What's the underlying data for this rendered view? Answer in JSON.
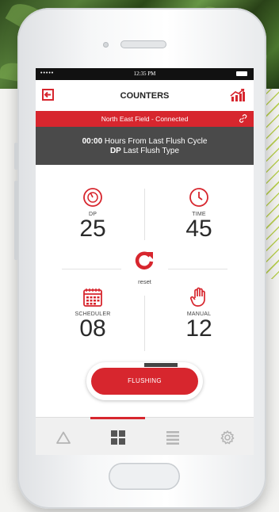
{
  "status_bar": {
    "signal": "••••• ",
    "time": "12:35 PM"
  },
  "header": {
    "title": "COUNTERS"
  },
  "connection": {
    "text": "North East Field - Connected"
  },
  "info": {
    "line1_bold": "00:00",
    "line1_text": " Hours From Last Flush Cycle",
    "line2_bold": "DP",
    "line2_text": " Last Flush Type"
  },
  "counters": [
    {
      "label": "DP",
      "value": "25",
      "icon": "gauge-icon"
    },
    {
      "label": "TIME",
      "value": "45",
      "icon": "clock-icon"
    },
    {
      "label": "SCHEDULER",
      "value": "08",
      "icon": "calendar-icon"
    },
    {
      "label": "MANUAL",
      "value": "12",
      "icon": "hand-icon"
    }
  ],
  "reset": {
    "label": "reset"
  },
  "flush_button": {
    "label": "FLUSHING"
  },
  "tabs": [
    {
      "icon": "alert-triangle-icon",
      "active": false
    },
    {
      "icon": "grid-icon",
      "active": true
    },
    {
      "icon": "list-icon",
      "active": false
    },
    {
      "icon": "gear-icon",
      "active": false
    }
  ],
  "colors": {
    "accent": "#d7262e",
    "info_bg": "#4a4a4a",
    "tab_inactive": "#b5b5b5"
  }
}
